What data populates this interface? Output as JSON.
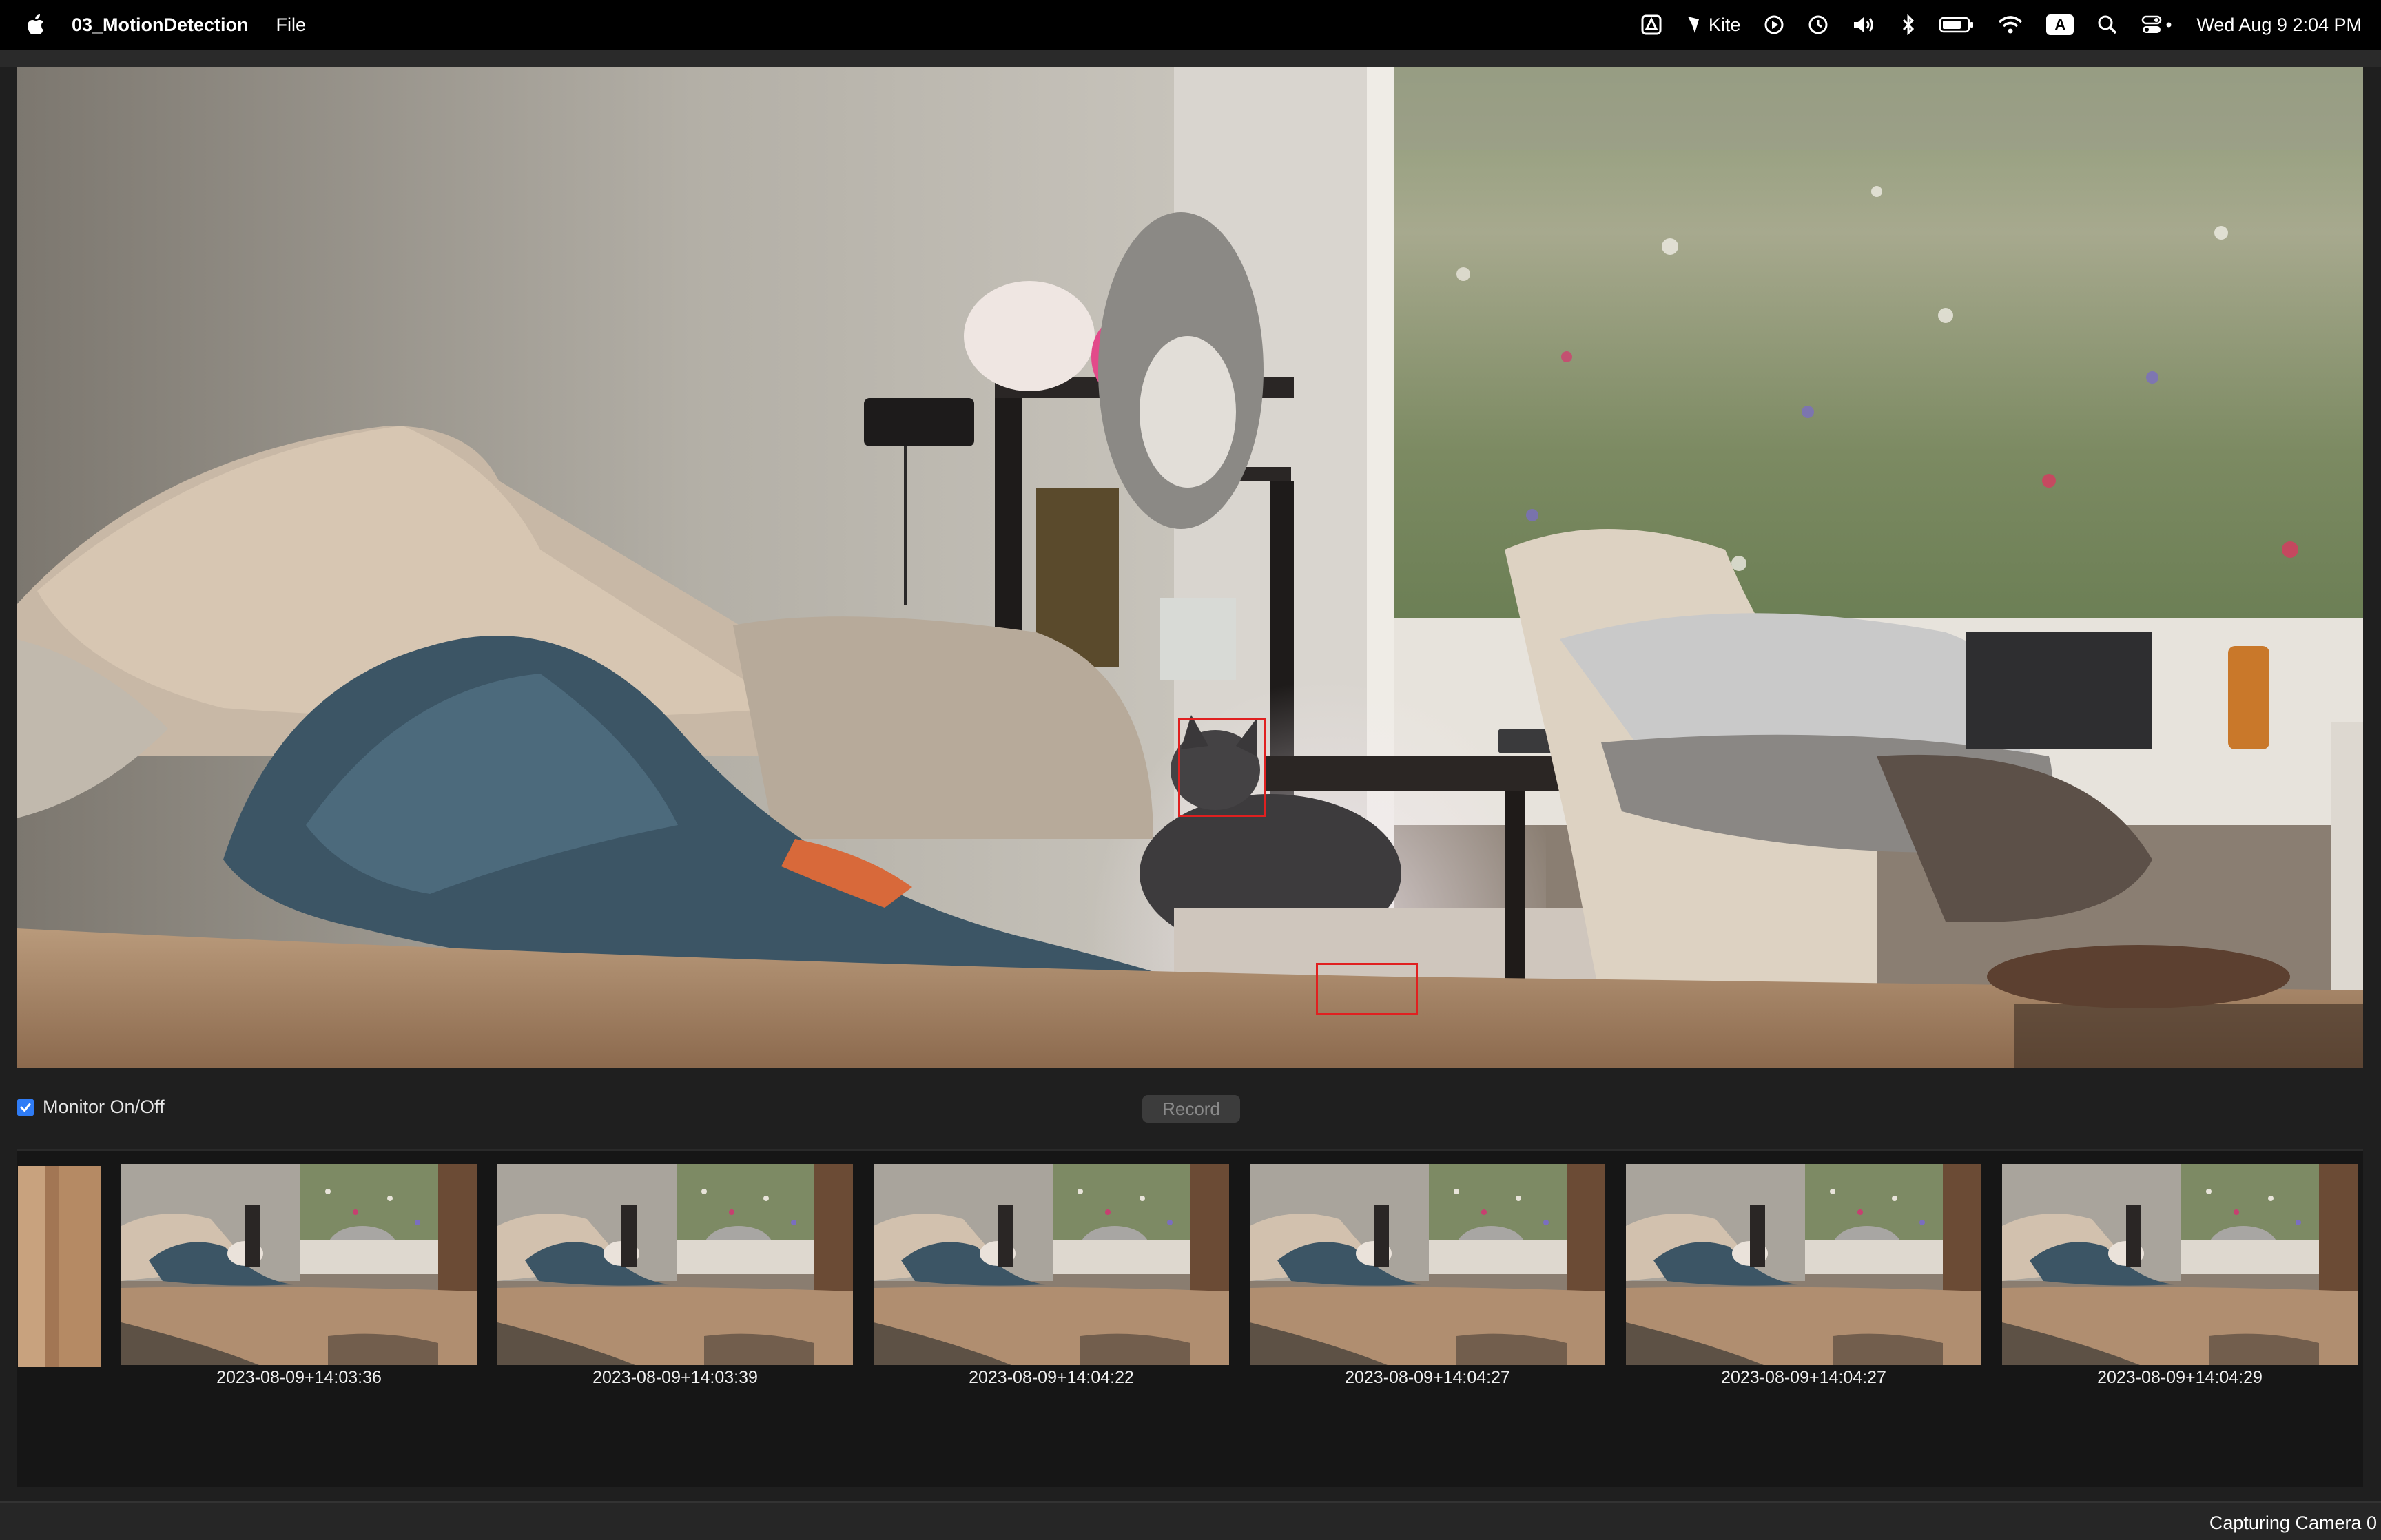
{
  "menubar": {
    "app_name": "03_MotionDetection",
    "menu_file": "File",
    "kite_label": "Kite",
    "input_badge": "A",
    "clock": "Wed Aug 9  2:04 PM"
  },
  "controls": {
    "monitor_label": "Monitor On/Off",
    "monitor_checked": true,
    "record_label": "Record"
  },
  "thumbnails": [
    {
      "timestamp": "2023-08-09+14:03:36"
    },
    {
      "timestamp": "2023-08-09+14:03:39"
    },
    {
      "timestamp": "2023-08-09+14:04:22"
    },
    {
      "timestamp": "2023-08-09+14:04:27"
    },
    {
      "timestamp": "2023-08-09+14:04:27"
    },
    {
      "timestamp": "2023-08-09+14:04:29"
    }
  ],
  "status": {
    "text": "Capturing Camera 0"
  },
  "colors": {
    "motion_box": "#e02020",
    "checkbox": "#2f7cf6"
  }
}
